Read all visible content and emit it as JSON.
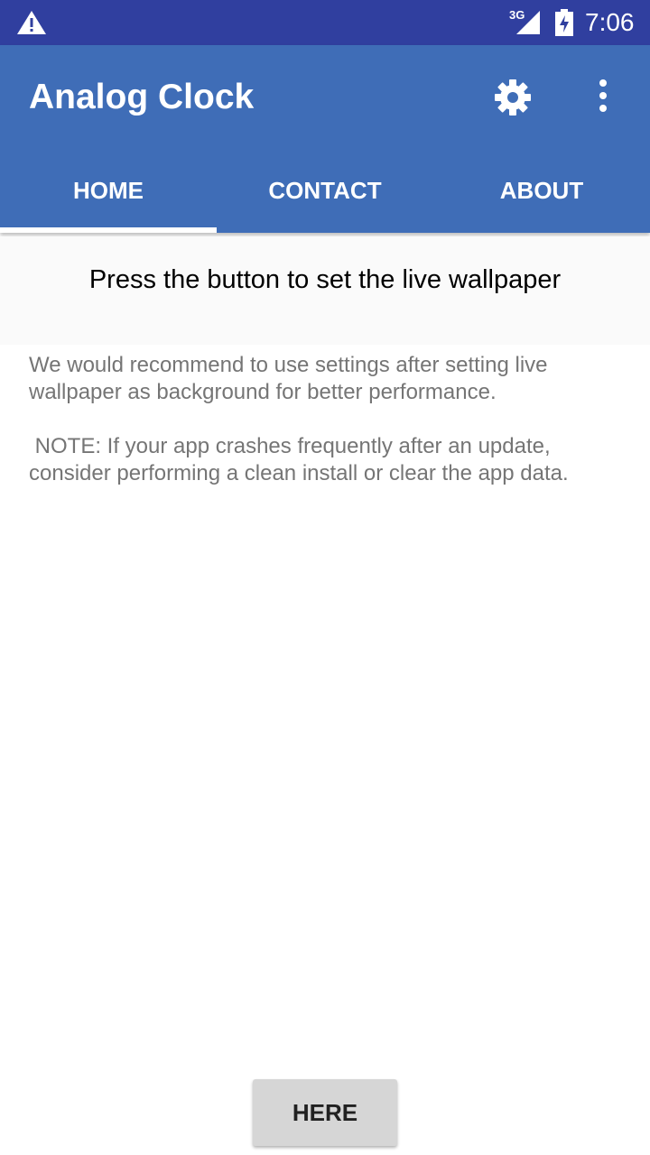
{
  "status_bar": {
    "network_label": "3G",
    "time": "7:06",
    "icons": [
      "warning-icon",
      "signal-icon",
      "battery-charging-icon"
    ]
  },
  "app_bar": {
    "title": "Analog Clock",
    "icons": [
      "gear-icon",
      "more-vertical-icon"
    ],
    "color": "#3f6db7",
    "status_color": "#303f9f"
  },
  "tabs": [
    {
      "label": "HOME",
      "selected": true
    },
    {
      "label": "CONTACT",
      "selected": false
    },
    {
      "label": "ABOUT",
      "selected": false
    }
  ],
  "main": {
    "headline": "Press the button to set the live wallpaper",
    "recommendation": "We would recommend to use settings after setting live wallpaper as background for better performance.",
    "note": " NOTE: If your app crashes frequently after an update, consider performing a clean install or clear the app data."
  },
  "action_button": {
    "label": "HERE"
  }
}
